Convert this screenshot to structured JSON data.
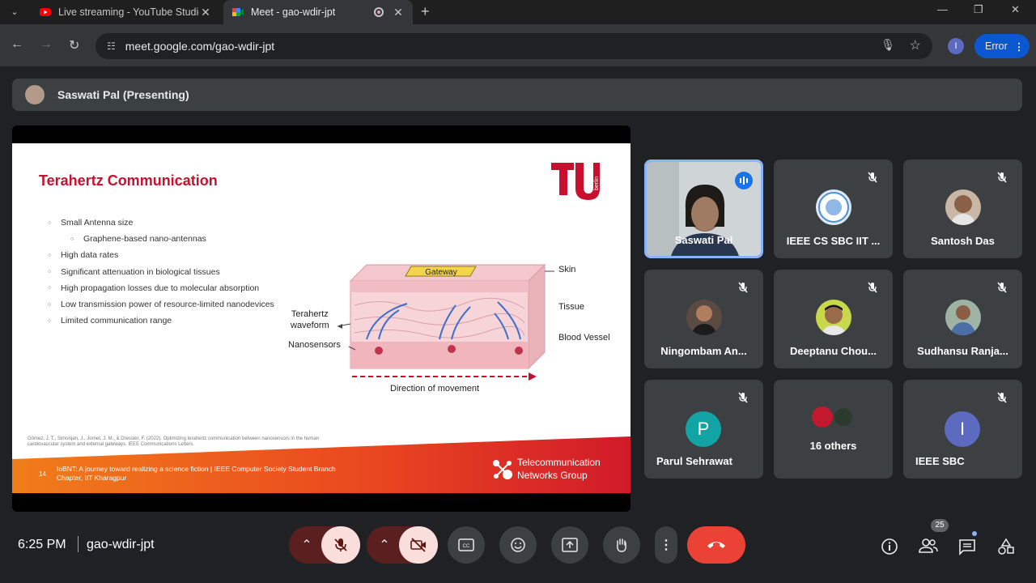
{
  "browser": {
    "tabs": [
      {
        "title": "Live streaming - YouTube Studio",
        "favicon": "youtube-icon"
      },
      {
        "title": "Meet - gao-wdir-jpt",
        "favicon": "meet-icon"
      }
    ],
    "url": "meet.google.com/gao-wdir-jpt",
    "profile_initial": "I",
    "error_label": "Error"
  },
  "presenter_bar": {
    "label": "Saswati Pal (Presenting)"
  },
  "slide": {
    "title": "Terahertz Communication",
    "bullets": [
      {
        "text": "Small Antenna size",
        "level": 0
      },
      {
        "text": "Graphene-based nano-antennas",
        "level": 1
      },
      {
        "text": "High data rates",
        "level": 0
      },
      {
        "text": "Significant attenuation in biological tissues",
        "level": 0
      },
      {
        "text": "High propagation losses due to molecular absorption",
        "level": 0
      },
      {
        "text": "Low transmission power of resource-limited nanodevices",
        "level": 0
      },
      {
        "text": "Limited communication range",
        "level": 0
      }
    ],
    "diagram": {
      "gateway": "Gateway",
      "skin": "Skin",
      "tissue": "Tissue",
      "blood_vessel": "Blood Vessel",
      "waveform_1": "Terahertz",
      "waveform_2": "waveform",
      "nanosensors": "Nanosensors",
      "direction": "Direction of movement"
    },
    "citation": "Gómez, J. T., Simonjan, J., Jornet, J. M., & Dressler, F. (2022). Optimizing terahertz communication between nanosensors in the human cardiovascular system and external gateways. IEEE Communications Letters.",
    "page_number": "14",
    "footer_line1": "IoBNT: A journey toward realizing a science fiction | IEEE Computer Society Student Branch",
    "footer_line2": "Chapter, IIT Kharagpur",
    "group_line1": "Telecommunication",
    "group_line2": "Networks Group",
    "logo_text": "berlin"
  },
  "participants": [
    {
      "name": "Saswati Pal",
      "speaking": true
    },
    {
      "name": "IEEE CS SBC IIT ...",
      "muted": true
    },
    {
      "name": "Santosh Das",
      "muted": true
    },
    {
      "name": "Ningombam An...",
      "muted": true
    },
    {
      "name": "Deeptanu Chou...",
      "muted": true
    },
    {
      "name": "Sudhansu Ranja...",
      "muted": true
    },
    {
      "name": "Parul Sehrawat",
      "initial": "P",
      "muted": true
    },
    {
      "name": "16 others"
    },
    {
      "name": "IEEE SBC",
      "initial": "I",
      "muted": true
    }
  ],
  "controls": {
    "time": "6:25 PM",
    "meeting_code": "gao-wdir-jpt",
    "people_count": "25"
  }
}
